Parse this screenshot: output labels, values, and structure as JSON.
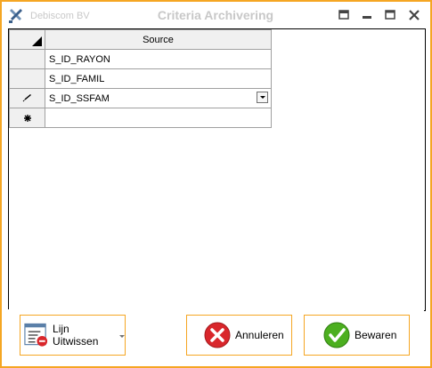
{
  "titlebar": {
    "app_name": "Debiscom BV",
    "title": "Criteria Archivering",
    "icons": [
      "app-tools-icon",
      "restore-icon",
      "minimize-icon",
      "maximize-icon",
      "close-icon"
    ]
  },
  "grid": {
    "column_header": "Source",
    "rows": [
      {
        "value": "S_ID_RAYON",
        "indicator": ""
      },
      {
        "value": "S_ID_FAMIL",
        "indicator": ""
      },
      {
        "value": "S_ID_SSFAM",
        "indicator": "edit-pencil-icon",
        "has_dropdown": true
      },
      {
        "value": "",
        "indicator": "new-row-star-icon"
      }
    ]
  },
  "buttons": {
    "delete_line": "Lijn Uitwissen",
    "cancel": "Annuleren",
    "save": "Bewaren"
  },
  "colors": {
    "window_border": "#f5a623",
    "title_text": "#c8c8c8",
    "cancel_icon": "#d9262b",
    "save_icon": "#4caf1f"
  }
}
